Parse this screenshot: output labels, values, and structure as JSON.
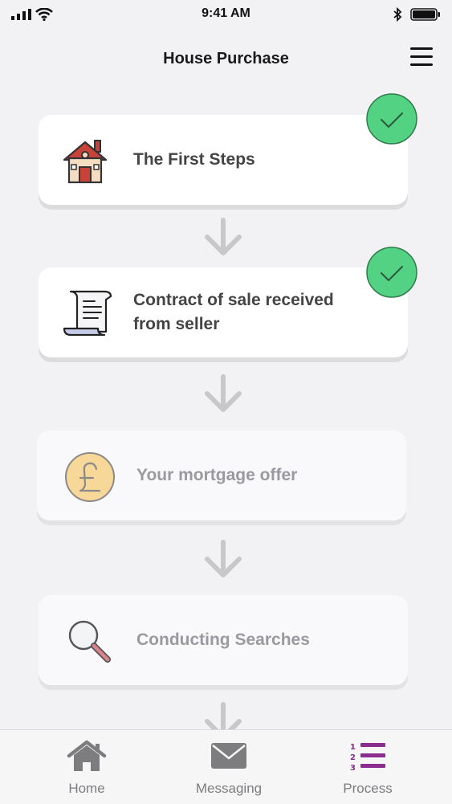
{
  "status": {
    "time": "9:41 AM"
  },
  "header": {
    "title": "House Purchase",
    "menu_icon": "hamburger-menu-icon"
  },
  "steps": [
    {
      "label": "The First Steps",
      "icon": "house-icon",
      "completed": true
    },
    {
      "label": "Contract of sale received from seller",
      "icon": "scroll-document-icon",
      "completed": true
    },
    {
      "label": "Your mortgage offer",
      "icon": "pound-coin-icon",
      "completed": false
    },
    {
      "label": "Conducting Searches",
      "icon": "magnifier-icon",
      "completed": false
    }
  ],
  "tabs": [
    {
      "label": "Home",
      "icon": "home-icon",
      "active": false
    },
    {
      "label": "Messaging",
      "icon": "envelope-icon",
      "active": false
    },
    {
      "label": "Process",
      "icon": "numbered-list-icon",
      "active": true
    }
  ],
  "colors": {
    "accent": "#8a2d8f",
    "check_green": "#52d282",
    "inactive_text": "#9a9a9e"
  }
}
